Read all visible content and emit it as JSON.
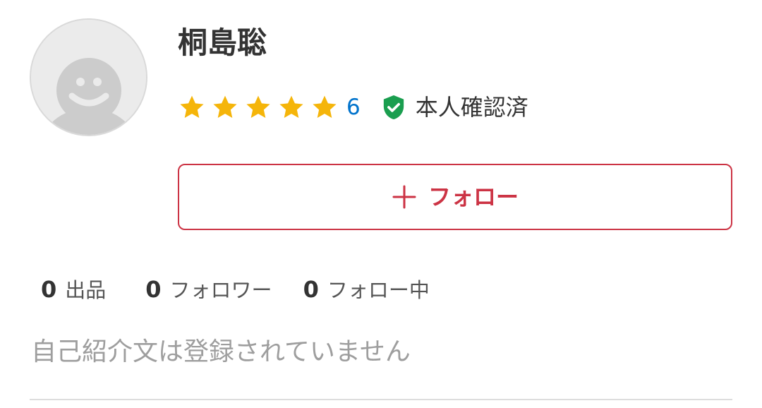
{
  "profile": {
    "avatar_icon": "default-user-avatar",
    "name": "桐島聡",
    "rating": {
      "stars": 5,
      "max_stars": 5,
      "count": "6",
      "star_color": "#f5b50a",
      "count_color": "#0073cc"
    },
    "verified": {
      "icon": "shield-check-icon",
      "label": "本人確認済",
      "color": "#1a9e4f"
    }
  },
  "follow_button": {
    "icon": "plus-icon",
    "label": "フォロー",
    "accent_color": "#cc3344"
  },
  "stats": [
    {
      "value": "0",
      "label": "出品"
    },
    {
      "value": "0",
      "label": "フォロワー"
    },
    {
      "value": "0",
      "label": "フォロー中"
    }
  ],
  "bio": {
    "text": "自己紹介文は登録されていません"
  }
}
